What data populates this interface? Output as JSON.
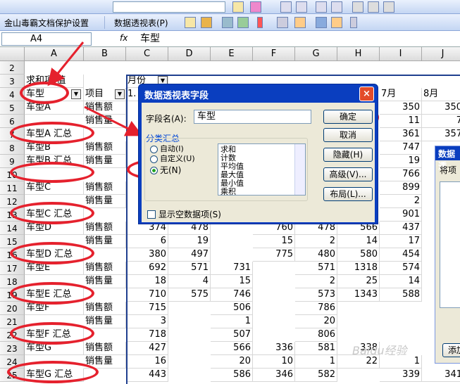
{
  "toolbar": {
    "wps_protect": "金山毒霸文档保护设置",
    "pivot_menu": "数据透视表(P)"
  },
  "formula": {
    "name_box": "A4",
    "fx": "fx",
    "content": "车型"
  },
  "columns": [
    "A",
    "B",
    "C",
    "D",
    "E",
    "F",
    "G",
    "H",
    "I",
    "J"
  ],
  "rows": [
    "2",
    "3",
    "4",
    "5",
    "6",
    "7",
    "8",
    "9",
    "10",
    "11",
    "12",
    "13",
    "14",
    "15",
    "16",
    "17",
    "18",
    "19",
    "20",
    "21",
    "22",
    "23",
    "24",
    "25"
  ],
  "sheet": {
    "a3": "求和项:值",
    "a4": "车型",
    "b4": "项目",
    "c3": "月份",
    "c4": "1.",
    "i4": "7月",
    "j4": "8月",
    "a5": "车型A",
    "b5": "销售额",
    "b6": "销售量",
    "a7": "车型A 汇总",
    "a8": "车型B",
    "b8": "销售额",
    "b9": "销售量",
    "a9": "车型B 汇总",
    "a11": "车型C",
    "b11": "销售额",
    "b12": "销售量",
    "a13": "车型C 汇总",
    "a14": "车型D",
    "b14": "销售额",
    "b15": "销售量",
    "a16": "车型D 汇总",
    "a17": "车型E",
    "b17": "销售额",
    "b18": "销售量",
    "a19": "车型E 汇总",
    "a20": "车型F",
    "b20": "销售额",
    "b21": "销售量",
    "a22": "车型F 汇总",
    "a23": "车型G",
    "b23": "销售额",
    "b24": "销售量",
    "a25": "车型G 汇总",
    "i5": "350",
    "j5": "350",
    "i6": "11",
    "j6": "7",
    "i7": "361",
    "j7": "357",
    "i8": "747",
    "i9": "19",
    "i10": "766",
    "i11": "899",
    "i12": "2",
    "i13": "901",
    "c14": "374",
    "d14": "478",
    "f14": "760",
    "g14": "478",
    "h14": "566",
    "i14": "437",
    "c15": "6",
    "d15": "19",
    "f15": "15",
    "g15": "2",
    "h15": "14",
    "i15": "17",
    "c16": "380",
    "d16": "497",
    "f16": "775",
    "g16": "480",
    "h16": "580",
    "i16": "454",
    "c17": "692",
    "d17": "571",
    "e17": "731",
    "g17": "571",
    "h17": "1318",
    "i17": "574",
    "c18": "18",
    "d18": "4",
    "e18": "15",
    "g18": "2",
    "h18": "25",
    "i18": "14",
    "c19": "710",
    "d19": "575",
    "e19": "746",
    "g19": "573",
    "h19": "1343",
    "i19": "588",
    "c20": "715",
    "e20": "506",
    "g20": "786",
    "c21": "3",
    "e21": "1",
    "g21": "20",
    "c22": "718",
    "e22": "507",
    "g22": "806",
    "c23": "427",
    "e23": "566",
    "f23": "336",
    "g23": "581",
    "h23": "338",
    "c24": "16",
    "e24": "20",
    "f24": "10",
    "g24": "1",
    "h24": "22",
    "i24": "1",
    "c25": "443",
    "e25": "586",
    "f25": "346",
    "g25": "582",
    "i25": "339",
    "j25": "341"
  },
  "dialog": {
    "title": "数据透视表字段",
    "field_label": "字段名(A):",
    "field_value": "车型",
    "subtotal_label": "分类汇总",
    "radio_auto": "自动(I)",
    "radio_custom": "自定义(U)",
    "radio_none": "无(N)",
    "list": [
      "求和",
      "计数",
      "平均值",
      "最大值",
      "最小值",
      "乘积"
    ],
    "show_empty": "显示空数据项(S)",
    "ok": "确定",
    "cancel": "取消",
    "hide": "隐藏(H)",
    "advanced": "高级(V)...",
    "layout": "布局(L)..."
  },
  "side_pane": {
    "title": "数据透",
    "item": "将项",
    "add": "添加"
  },
  "watermark": "Baidu经验"
}
